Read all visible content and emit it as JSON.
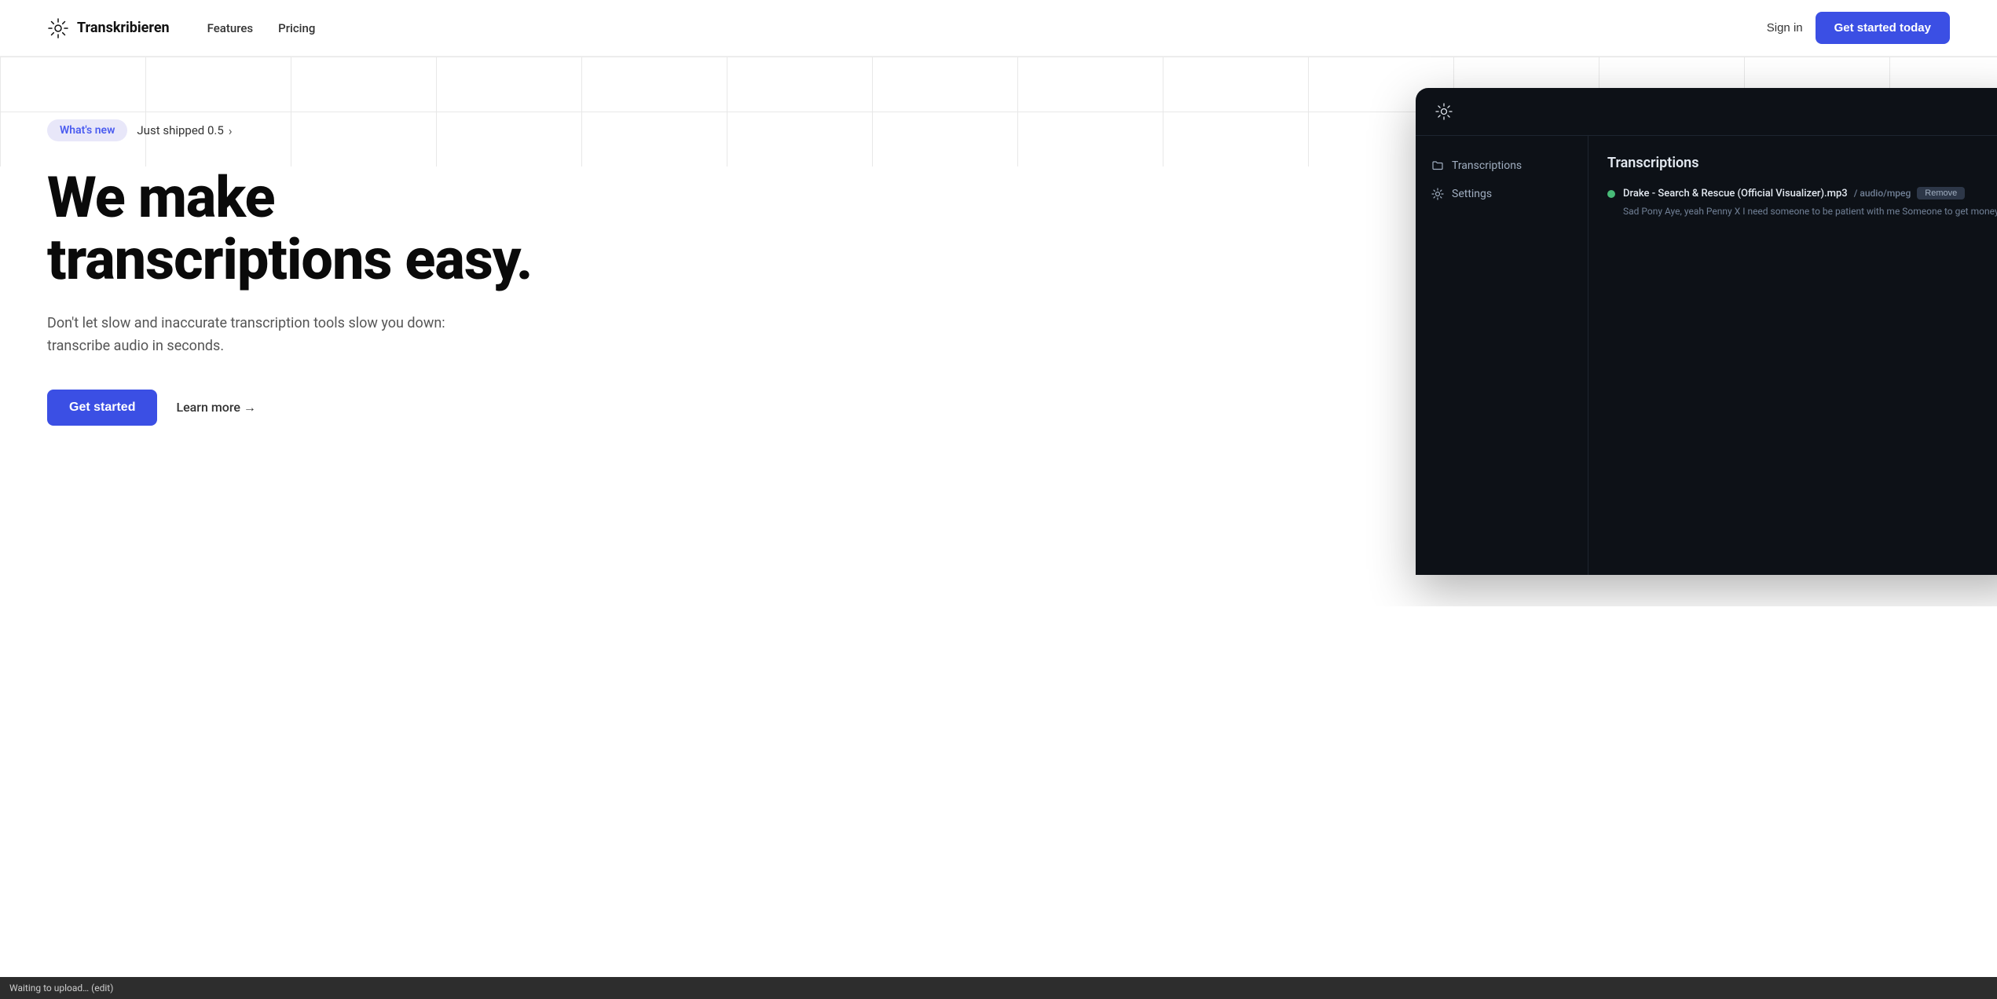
{
  "nav": {
    "logo_text": "Transkribieren",
    "links": [
      {
        "label": "Features",
        "href": "#"
      },
      {
        "label": "Pricing",
        "href": "#"
      }
    ],
    "sign_in_label": "Sign in",
    "get_started_label": "Get started today"
  },
  "hero": {
    "badge": {
      "tag": "What's new",
      "text": "Just shipped 0.5",
      "arrow": "›"
    },
    "title_line1": "We make",
    "title_line2": "transcriptions easy.",
    "subtitle": "Don't let slow and inaccurate transcription tools slow you down: transcribe audio in seconds.",
    "get_started_label": "Get started",
    "learn_more_label": "Learn more →"
  },
  "app": {
    "sidebar": {
      "items": [
        {
          "label": "Transcriptions",
          "icon": "folder-icon"
        },
        {
          "label": "Settings",
          "icon": "gear-icon"
        }
      ]
    },
    "main": {
      "title": "Transcriptions",
      "file_name": "Drake - Search & Rescue (Official Visualizer).mp3",
      "file_type": "audio/mpeg",
      "remove_label": "Remove",
      "transcription_text": "Sad Pony Aye, yeah Penny X I need someone to be patient with me Someone to get money when I take it fro..."
    }
  },
  "status_bar": {
    "text": "Waiting to upload… (edit)"
  },
  "colors": {
    "accent": "#3b4fe4",
    "badge_bg": "#e8e7f9",
    "badge_text": "#4b5cf0",
    "app_bg": "#0d1117",
    "green_dot": "#48bb78"
  }
}
